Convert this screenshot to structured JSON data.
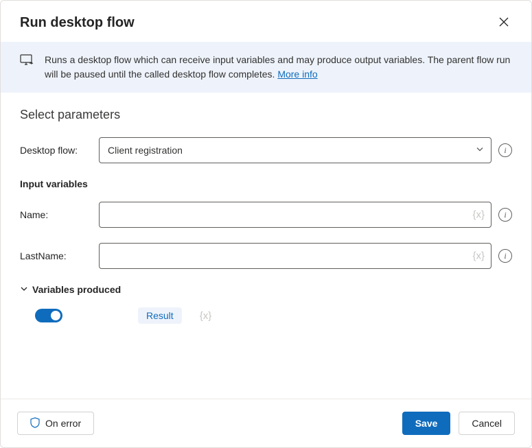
{
  "dialog": {
    "title": "Run desktop flow",
    "description": "Runs a desktop flow which can receive input variables and may produce output variables. The parent flow run will be paused until the called desktop flow completes. ",
    "moreInfoLabel": "More info"
  },
  "parameters": {
    "sectionTitle": "Select parameters",
    "desktopFlowLabel": "Desktop flow:",
    "desktopFlowValue": "Client registration",
    "inputVariablesTitle": "Input variables",
    "inputs": {
      "nameLabel": "Name:",
      "nameValue": "",
      "lastNameLabel": "LastName:",
      "lastNameValue": ""
    },
    "producedTitle": "Variables produced",
    "producedChip": "Result"
  },
  "footer": {
    "onErrorLabel": "On error",
    "saveLabel": "Save",
    "cancelLabel": "Cancel"
  }
}
